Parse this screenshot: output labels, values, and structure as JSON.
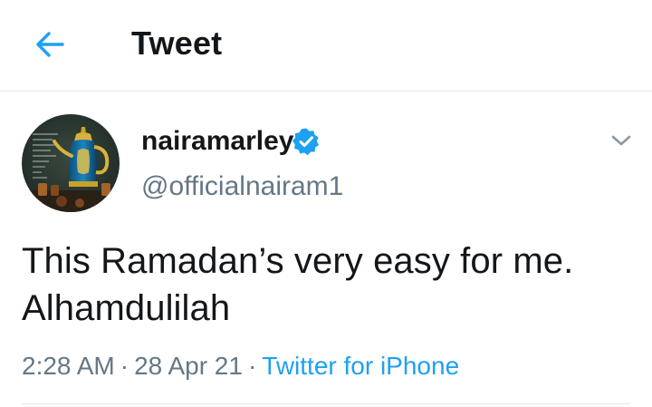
{
  "header": {
    "back_icon": "arrow-left-icon",
    "title": "Tweet"
  },
  "author": {
    "display_name": "nairamarley",
    "handle": "@officialnairam1",
    "verified": true,
    "verified_icon": "verified-badge-icon",
    "avatar_icon": "avatar-teapot-image"
  },
  "menu": {
    "icon": "chevron-down-icon"
  },
  "tweet": {
    "lines": [
      "This Ramadan’s very easy for me.",
      "Alhamdulilah"
    ]
  },
  "meta": {
    "time": "2:28 AM",
    "separator": "·",
    "date": "28 Apr 21",
    "source": "Twitter for iPhone"
  },
  "colors": {
    "accent": "#1da1f2",
    "text": "#14171a",
    "muted": "#657786",
    "divider": "#e1e8ed"
  }
}
